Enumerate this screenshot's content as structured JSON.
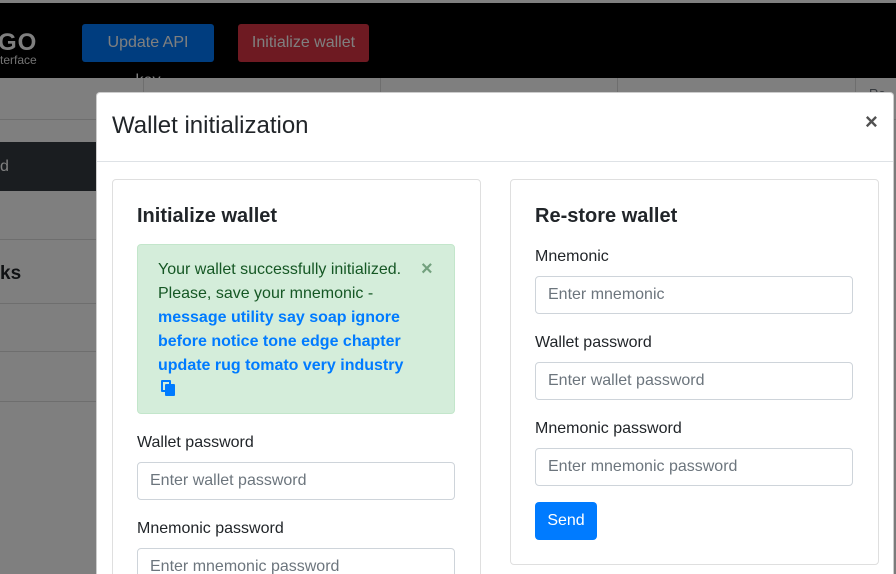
{
  "app": {
    "brand_name": "GO",
    "brand_sub": "terface",
    "update_api_label": "Update API key",
    "init_wallet_label": "Initialize wallet",
    "side_item_partial": "d",
    "side_heading_partial": "ks",
    "right_partial": "Re"
  },
  "modal": {
    "title": "Wallet initialization",
    "close_glyph": "×"
  },
  "init_card": {
    "title": "Initialize wallet",
    "alert": {
      "message": "Your wallet successfully initialized. Please, save your mnemonic - ",
      "mnemonic": "message utility say soap ignore before notice tone edge chapter update rug tomato very industry",
      "close_glyph": "×"
    },
    "wallet_password_label": "Wallet password",
    "wallet_password_placeholder": "Enter wallet password",
    "mnemonic_password_label": "Mnemonic password",
    "mnemonic_password_placeholder": "Enter mnemonic password"
  },
  "restore_card": {
    "title": "Re-store wallet",
    "mnemonic_label": "Mnemonic",
    "mnemonic_placeholder": "Enter mnemonic",
    "wallet_password_label": "Wallet password",
    "wallet_password_placeholder": "Enter wallet password",
    "mnemonic_password_label": "Mnemonic password",
    "mnemonic_password_placeholder": "Enter mnemonic password",
    "send_label": "Send"
  },
  "colors": {
    "primary": "#007bff",
    "danger": "#dc3545",
    "success_bg": "#d4edda",
    "success_text": "#155724"
  }
}
